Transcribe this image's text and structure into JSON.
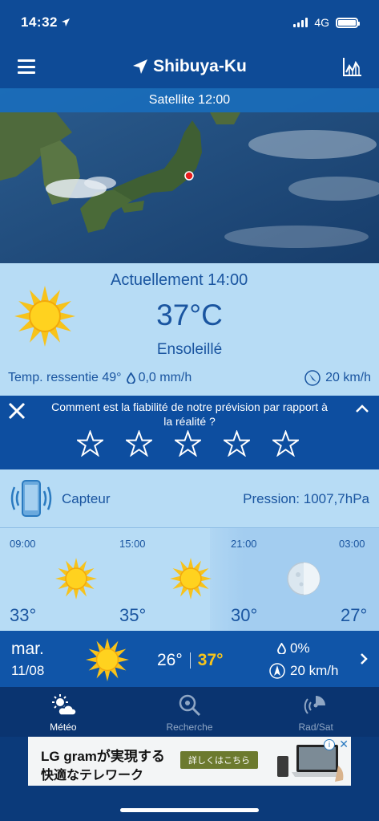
{
  "status": {
    "time": "14:32",
    "network": "4G"
  },
  "header": {
    "city": "Shibuya-Ku"
  },
  "satellite": {
    "label": "Satellite  12:00"
  },
  "current": {
    "title": "Actuellement 14:00",
    "temperature": "37°C",
    "condition": "Ensoleillé",
    "feels_like": "Temp. ressentie 49°",
    "precipitation": "0,0 mm/h",
    "wind": "20 km/h"
  },
  "feedback": {
    "question": "Comment est la fiabilité de notre prévision par rapport à la réalité ?",
    "rating_max": 5,
    "rating_value": 0
  },
  "sensor": {
    "label": "Capteur",
    "pressure": "Pression: 1007,7hPa"
  },
  "hourly": [
    {
      "time": "09:00",
      "temp": "33°",
      "icon": "sun-icon"
    },
    {
      "time": "15:00",
      "temp": "35°",
      "icon": "sun-icon"
    },
    {
      "time": "21:00",
      "temp": "30°",
      "icon": "moon-icon"
    },
    {
      "time": "03:00",
      "temp": "27°",
      "icon": "none"
    }
  ],
  "daily": {
    "day": "mar.",
    "date": "11/08",
    "min": "26°",
    "max": "37°",
    "rain_prob": "0%",
    "wind": "20 km/h"
  },
  "tabs": [
    {
      "label": "Météo",
      "icon": "weather-icon",
      "active": true
    },
    {
      "label": "Recherche",
      "icon": "search-icon",
      "active": false
    },
    {
      "label": "Rad/Sat",
      "icon": "radar-icon",
      "active": false
    }
  ],
  "ad": {
    "line1": "LG gramが実現する",
    "line2": "快適なテレワーク",
    "cta": "詳しくはこちら"
  },
  "colors": {
    "accent": "#0e4b97",
    "panel": "#b7dcf5",
    "text_dark": "#1a55a0",
    "max_temp": "#f7c51c"
  }
}
